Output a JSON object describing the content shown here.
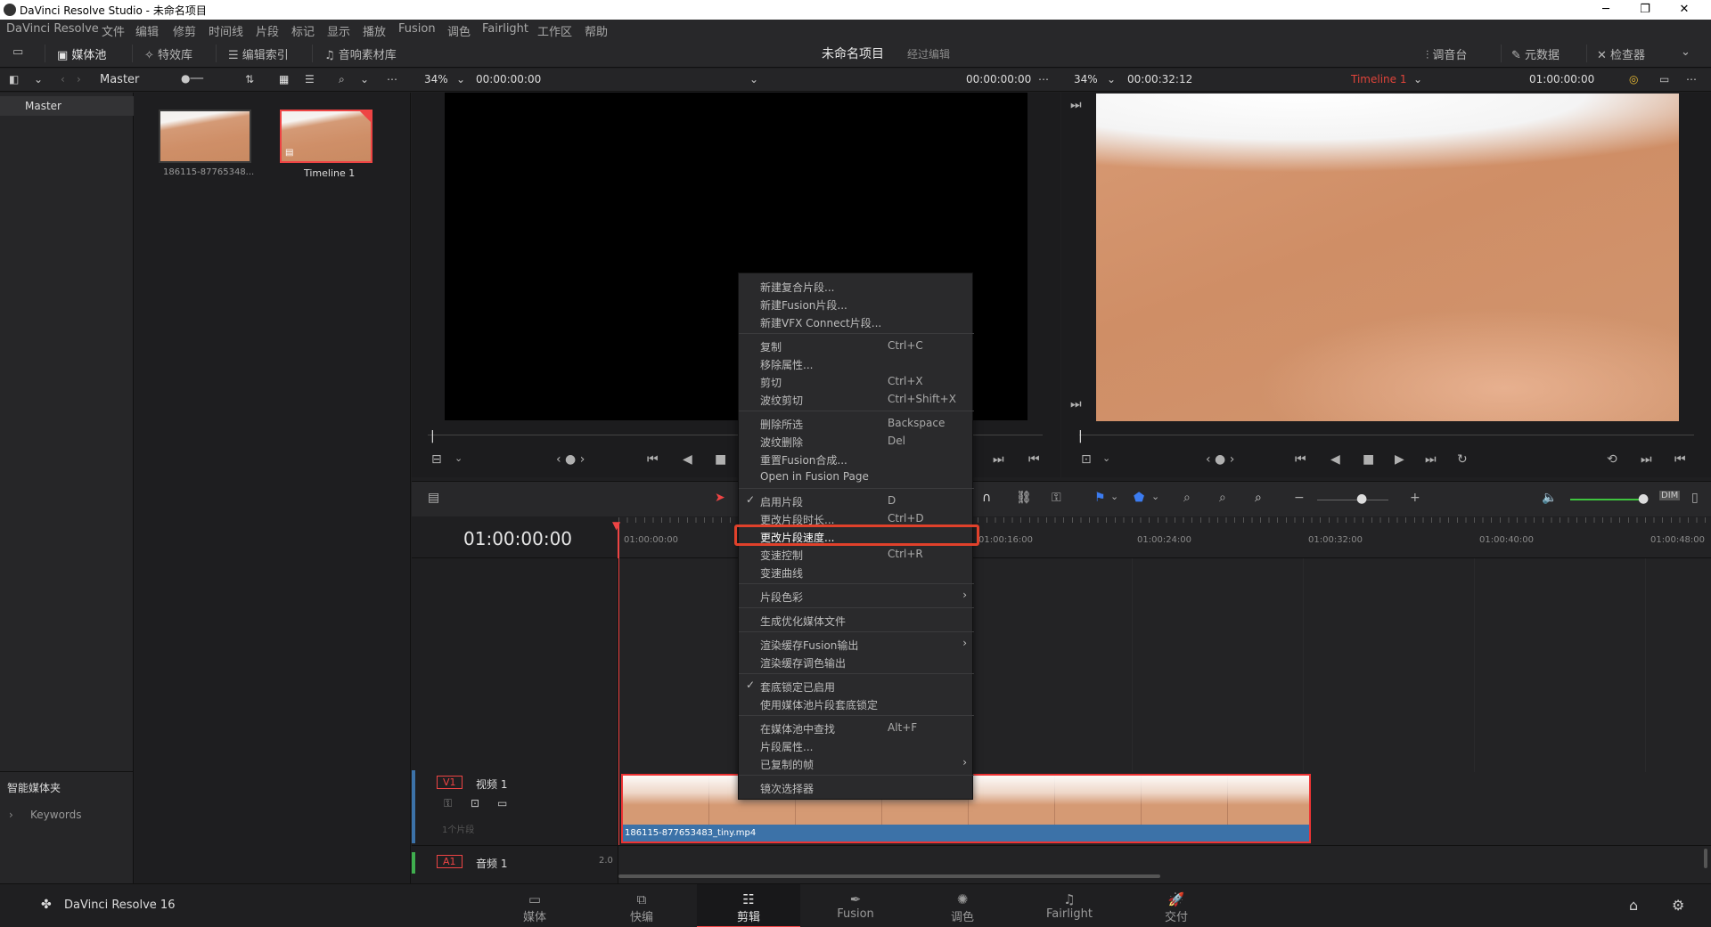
{
  "window": {
    "title": "DaVinci Resolve Studio - 未命名项目",
    "minimize": "─",
    "maximize": "❐",
    "close": "✕"
  },
  "menu": [
    "DaVinci Resolve",
    "文件",
    "编辑",
    "修剪",
    "时间线",
    "片段",
    "标记",
    "显示",
    "播放",
    "Fusion",
    "调色",
    "Fairlight",
    "工作区",
    "帮助"
  ],
  "toolbar": {
    "media_pool": "媒体池",
    "effects": "特效库",
    "edit_index": "编辑索引",
    "sound_library": "音响素材库",
    "project_name": "未命名项目",
    "edit_status": "经过编辑",
    "mixer": "调音台",
    "metadata": "元数据",
    "inspector": "检查器"
  },
  "subbar": {
    "bin_name": "Master",
    "source_zoom": "34%",
    "source_tc_left": "00:00:00:00",
    "source_tc_right": "00:00:00:00",
    "timeline_zoom": "34%",
    "timeline_duration": "00:00:32:12",
    "timeline_name": "Timeline 1",
    "timeline_tc": "01:00:00:00"
  },
  "bins": {
    "master": "Master",
    "smart_bins": "智能媒体夹",
    "keywords": "Keywords"
  },
  "media_items": [
    {
      "name": "186115-87765348..."
    },
    {
      "name": "Timeline 1"
    }
  ],
  "timeline": {
    "timecode": "01:00:00:00",
    "ruler": [
      "01:00:00:00",
      "01:00:16:00",
      "01:00:24:00",
      "01:00:32:00",
      "01:00:40:00",
      "01:00:48:00"
    ],
    "v1_tag": "V1",
    "v1_name": "视频 1",
    "v1_count": "1个片段",
    "a1_tag": "A1",
    "a1_name": "音频 1",
    "a1_level": "2.0",
    "clip_name": "186115-877653483_tiny.mp4"
  },
  "context_menu": [
    {
      "label": "新建复合片段...",
      "shortcut": ""
    },
    {
      "label": "新建Fusion片段...",
      "shortcut": ""
    },
    {
      "label": "新建VFX Connect片段...",
      "shortcut": ""
    },
    {
      "label": "复制",
      "shortcut": "Ctrl+C"
    },
    {
      "label": "移除属性...",
      "shortcut": ""
    },
    {
      "label": "剪切",
      "shortcut": "Ctrl+X"
    },
    {
      "label": "波纹剪切",
      "shortcut": "Ctrl+Shift+X"
    },
    {
      "label": "删除所选",
      "shortcut": "Backspace"
    },
    {
      "label": "波纹删除",
      "shortcut": "Del"
    },
    {
      "label": "重置Fusion合成...",
      "shortcut": ""
    },
    {
      "label": "Open in Fusion Page",
      "shortcut": ""
    },
    {
      "label": "启用片段",
      "shortcut": "D"
    },
    {
      "label": "更改片段时长...",
      "shortcut": "Ctrl+D"
    },
    {
      "label": "更改片段速度...",
      "shortcut": ""
    },
    {
      "label": "变速控制",
      "shortcut": "Ctrl+R"
    },
    {
      "label": "变速曲线",
      "shortcut": ""
    },
    {
      "label": "片段色彩",
      "shortcut": ""
    },
    {
      "label": "生成优化媒体文件",
      "shortcut": ""
    },
    {
      "label": "渲染缓存Fusion输出",
      "shortcut": ""
    },
    {
      "label": "渲染缓存调色输出",
      "shortcut": ""
    },
    {
      "label": "套底锁定已启用",
      "shortcut": ""
    },
    {
      "label": "使用媒体池片段套底锁定",
      "shortcut": ""
    },
    {
      "label": "在媒体池中查找",
      "shortcut": "Alt+F"
    },
    {
      "label": "片段属性...",
      "shortcut": ""
    },
    {
      "label": "已复制的帧",
      "shortcut": ""
    },
    {
      "label": "镜次选择器",
      "shortcut": ""
    }
  ],
  "bottom": {
    "brand": "DaVinci Resolve 16",
    "pages": [
      "媒体",
      "快编",
      "剪辑",
      "Fusion",
      "调色",
      "Fairlight",
      "交付"
    ]
  }
}
